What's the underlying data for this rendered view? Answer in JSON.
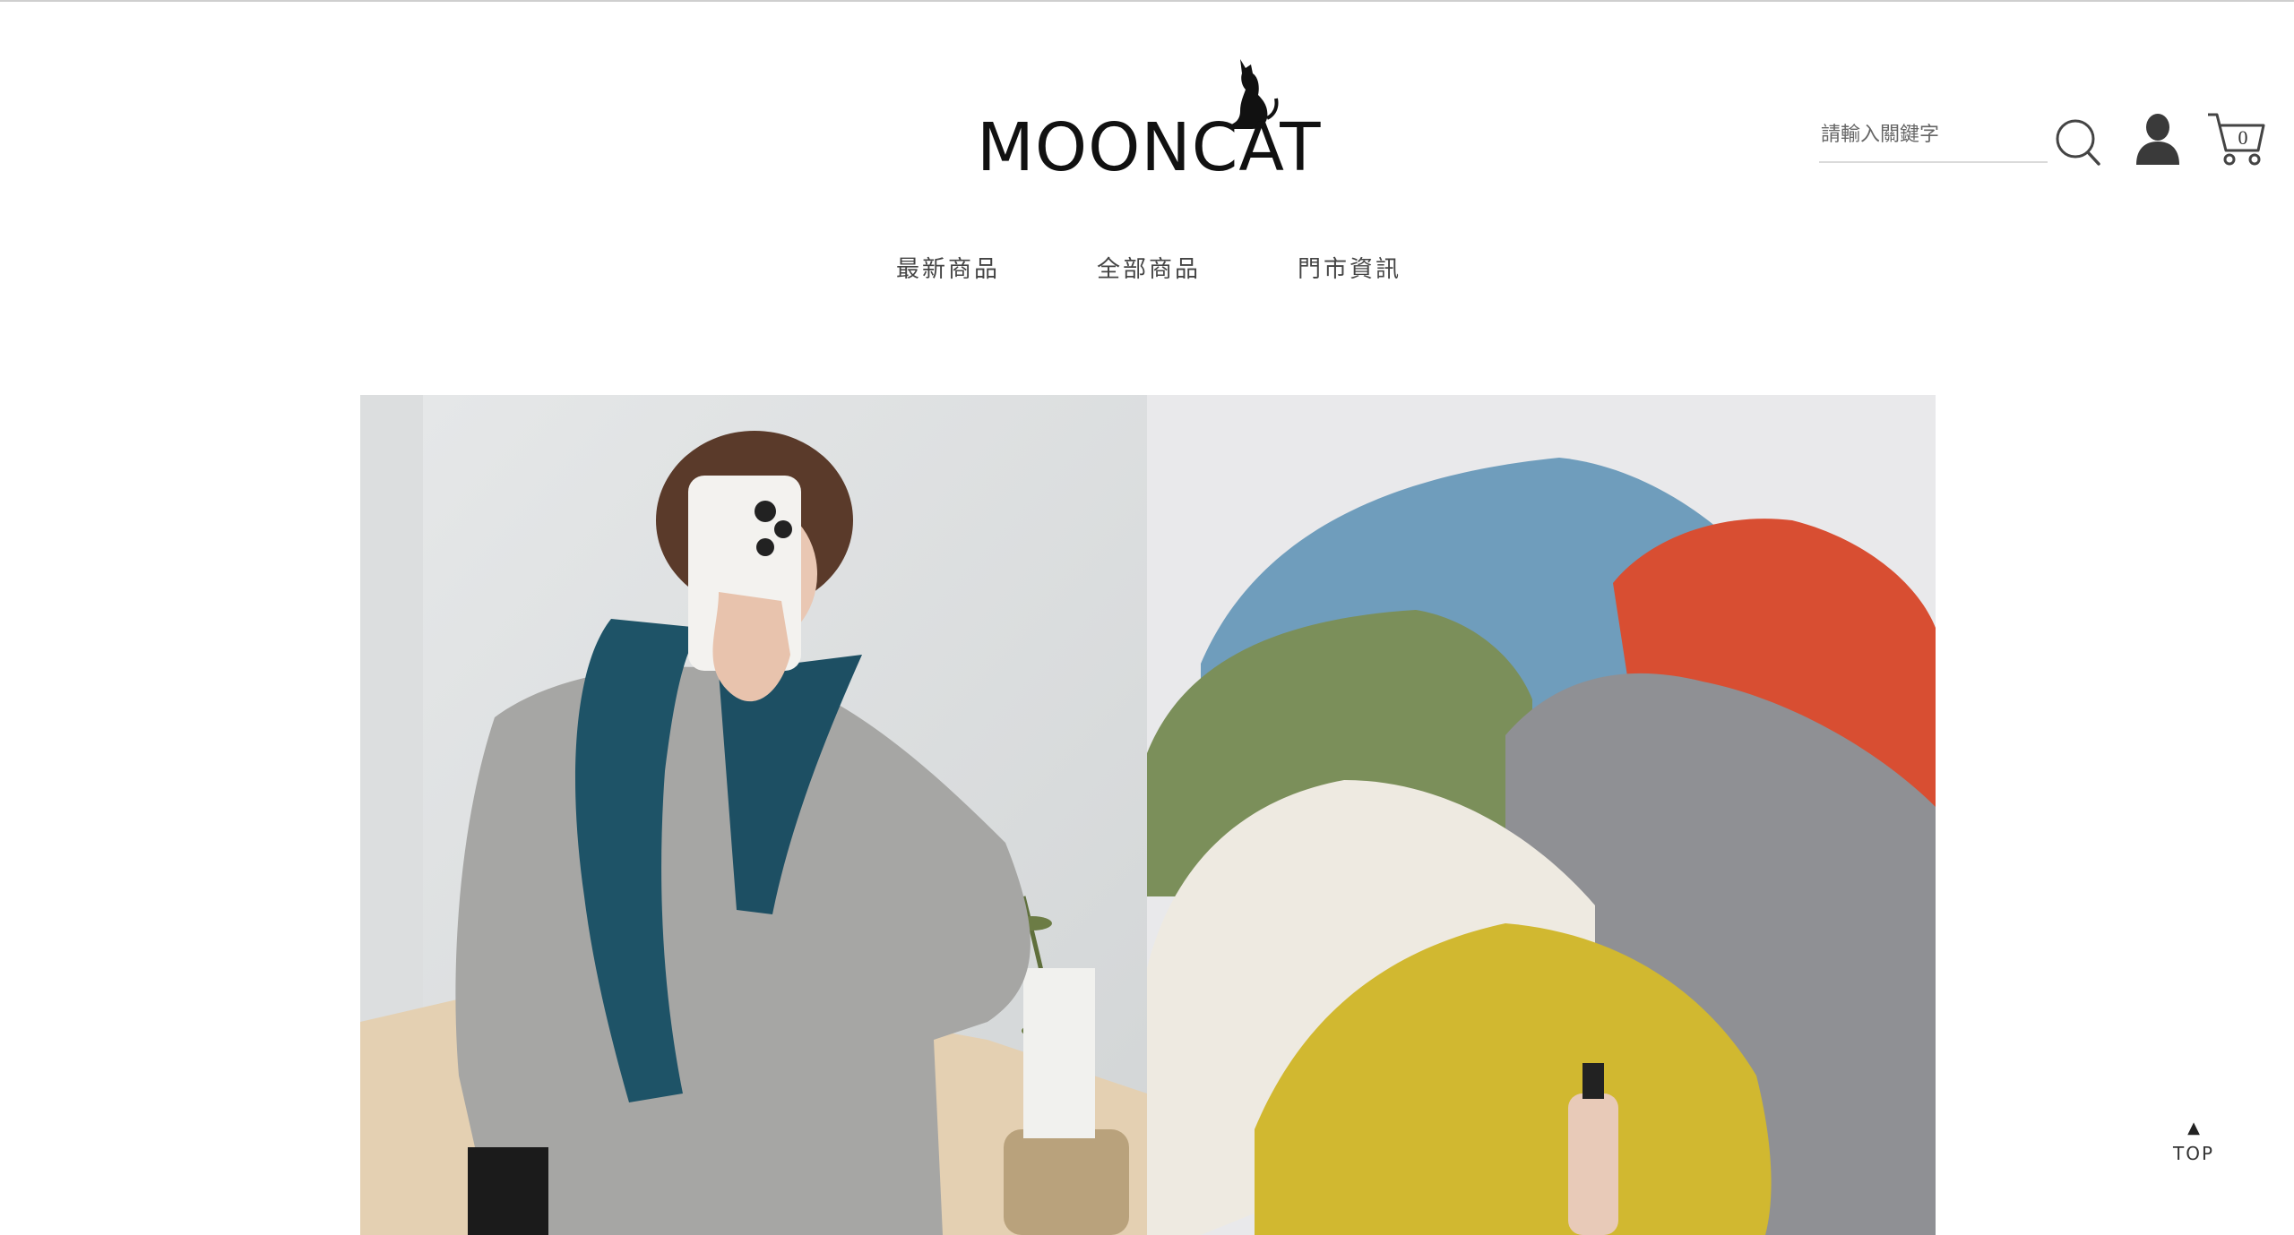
{
  "brand": {
    "name": "MOONCAT"
  },
  "header": {
    "search_placeholder": "請輸入關鍵字",
    "search_icon": "search-icon",
    "user_icon": "user-icon",
    "cart_icon": "cart-icon",
    "cart_count": "0"
  },
  "nav": {
    "items": [
      {
        "label": "最新商品"
      },
      {
        "label": "全部商品"
      },
      {
        "label": "門市資訊"
      }
    ]
  },
  "banner": {
    "left_image": "model-mirror-selfie-grey-sweater",
    "right_image": "folded-knit-sweaters-colors"
  },
  "back_to_top": {
    "arrow": "▲",
    "label": "TOP"
  }
}
